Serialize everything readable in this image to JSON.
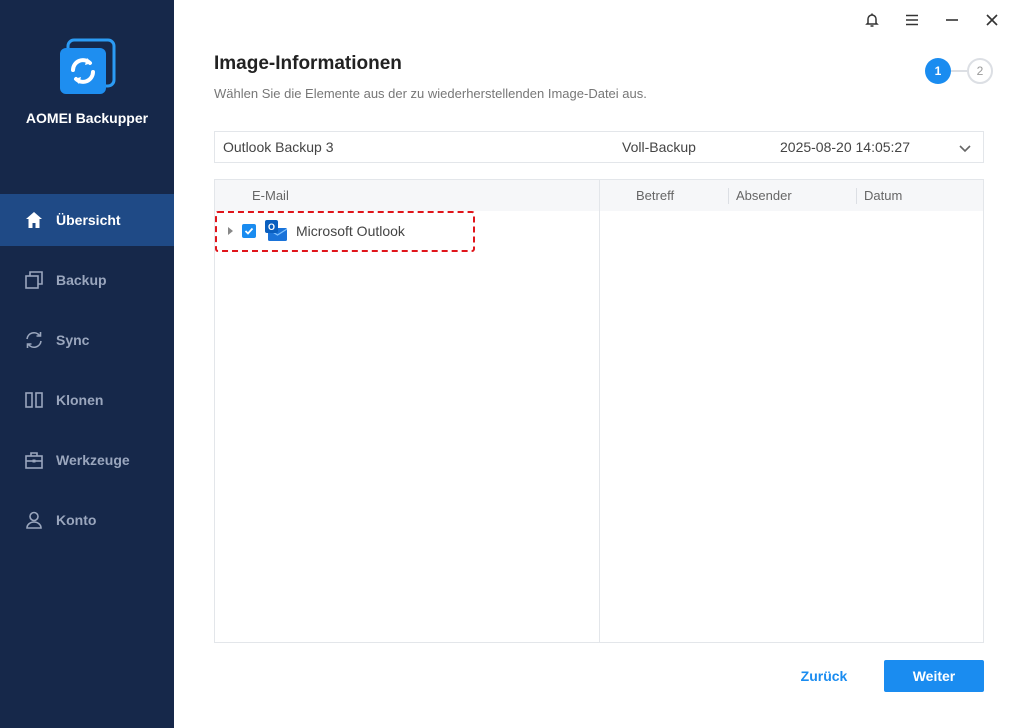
{
  "app": {
    "name": "AOMEI Backupper"
  },
  "sidebar": {
    "items": [
      {
        "label": "Übersicht",
        "icon": "home-icon",
        "active": true
      },
      {
        "label": "Backup",
        "icon": "backup-icon",
        "active": false
      },
      {
        "label": "Sync",
        "icon": "sync-icon",
        "active": false
      },
      {
        "label": "Klonen",
        "icon": "clone-icon",
        "active": false
      },
      {
        "label": "Werkzeuge",
        "icon": "toolbox-icon",
        "active": false
      },
      {
        "label": "Konto",
        "icon": "user-icon",
        "active": false
      }
    ]
  },
  "header": {
    "title": "Image-Informationen",
    "subtitle": "Wählen Sie die Elemente aus der zu wiederherstellenden Image-Datei aus."
  },
  "steps": {
    "current": "1",
    "next": "2"
  },
  "selector": {
    "name": "Outlook Backup 3",
    "type": "Voll-Backup",
    "datetime": "2025-08-20 14:05:27"
  },
  "left_pane": {
    "header": "E-Mail",
    "tree": [
      {
        "label": "Microsoft Outlook",
        "checked": true,
        "expanded": false
      }
    ]
  },
  "right_pane": {
    "columns": [
      "Betreff",
      "Absender",
      "Datum"
    ]
  },
  "footer": {
    "back_label": "Zurück",
    "next_label": "Weiter"
  },
  "colors": {
    "sidebar_bg": "#16284a",
    "sidebar_active": "#1f4a86",
    "accent": "#1a8cf0",
    "highlight": "#e0151b"
  }
}
